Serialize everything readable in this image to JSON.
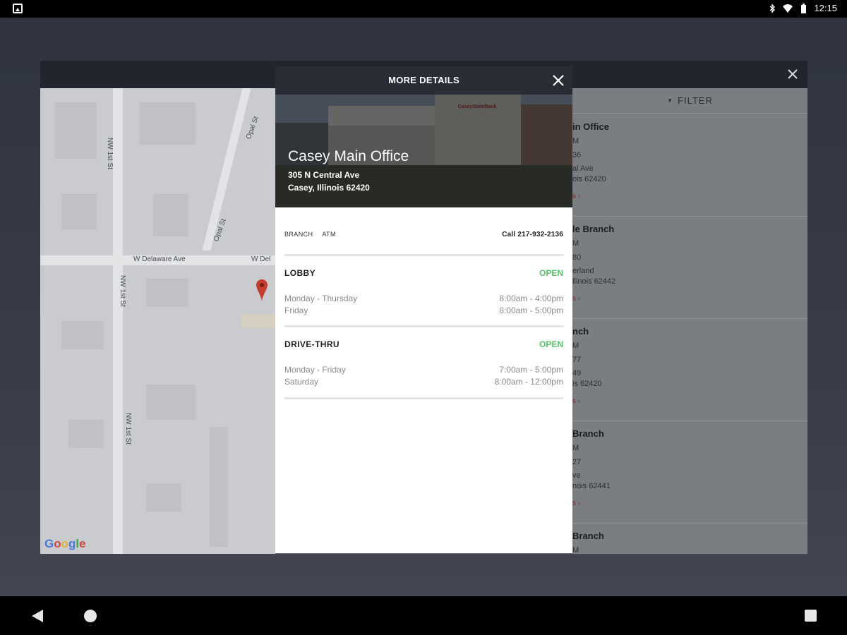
{
  "status_bar": {
    "time": "12:15",
    "icons": [
      "image-icon",
      "bluetooth-icon",
      "wifi-icon",
      "battery-icon"
    ]
  },
  "background": {
    "list_header": "FILTER",
    "list_items": [
      {
        "name": "in Office",
        "line1": "M",
        "line2": "36",
        "line3": "al Ave",
        "line4": "ois 62420",
        "link": "s ›"
      },
      {
        "name": "le Branch",
        "line1": "M",
        "line2": "80",
        "line3": "erland",
        "line4": "llinois 62442",
        "link": "s ›"
      },
      {
        "name": "nch",
        "line1": "M",
        "line2": "77",
        "line3": "49",
        "line4": "is 62420",
        "link": "s ›"
      },
      {
        "name": "Branch",
        "line1": "M",
        "line2": "27",
        "line3": "ve",
        "line4": "nois 62441",
        "link": "s ›"
      },
      {
        "name": "Branch",
        "line1": "M",
        "line2": "",
        "line3": "",
        "line4": "",
        "link": ""
      }
    ],
    "map": {
      "streets": [
        "NW 1st St",
        "Opal St",
        "Opal St",
        "W Delaware Ave",
        "W Del",
        "NW 1st St",
        "NW 1st St"
      ],
      "logo": "Google"
    }
  },
  "modal": {
    "title": "MORE DETAILS",
    "location_name": "Casey Main Office",
    "address_line1": "305 N Central Ave",
    "address_line2": "Casey, Illinois 62420",
    "sign_text": "CaseyStateBank",
    "tags": [
      "BRANCH",
      "ATM"
    ],
    "call_label": "Call 217-932-2136",
    "sections": [
      {
        "title": "LOBBY",
        "status": "OPEN",
        "rows": [
          {
            "day": "Monday - Thursday",
            "time": "8:00am - 4:00pm"
          },
          {
            "day": "Friday",
            "time": "8:00am - 5:00pm"
          }
        ]
      },
      {
        "title": "DRIVE-THRU",
        "status": "OPEN",
        "rows": [
          {
            "day": "Monday - Friday",
            "time": "7:00am - 5:00pm"
          },
          {
            "day": "Saturday",
            "time": "8:00am - 12:00pm"
          }
        ]
      }
    ]
  },
  "colors": {
    "open_status": "#57c26b",
    "modal_header": "#2a2d36",
    "accent_link": "#b03030"
  }
}
